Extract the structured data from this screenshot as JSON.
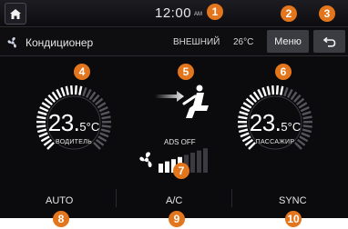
{
  "status": {
    "time": "12:00",
    "ampm": "AM"
  },
  "header": {
    "title": "Кондиционер",
    "exterior_label": "ВНЕШНИЙ",
    "exterior_temp": "26°C",
    "menu_label": "Меню"
  },
  "driver": {
    "temp_main": "23.",
    "temp_decimal": "5",
    "unit": "°C",
    "label": "ВОДИТЕЛЬ",
    "level": 0.55
  },
  "passenger": {
    "temp_main": "23.",
    "temp_decimal": "5",
    "unit": "°C",
    "label": "ПАССАЖИР",
    "level": 0.55
  },
  "airflow": {
    "ads_label": "ADS OFF",
    "fan_level": 4,
    "fan_max": 8
  },
  "bottom": {
    "auto_label": "AUTO",
    "ac_label": "A/C",
    "sync_label": "SYNC"
  },
  "callouts": [
    "1",
    "2",
    "3",
    "4",
    "5",
    "6",
    "7",
    "8",
    "9",
    "10"
  ],
  "colors": {
    "callout": "#e3761d",
    "background": "#0b0b0d"
  }
}
